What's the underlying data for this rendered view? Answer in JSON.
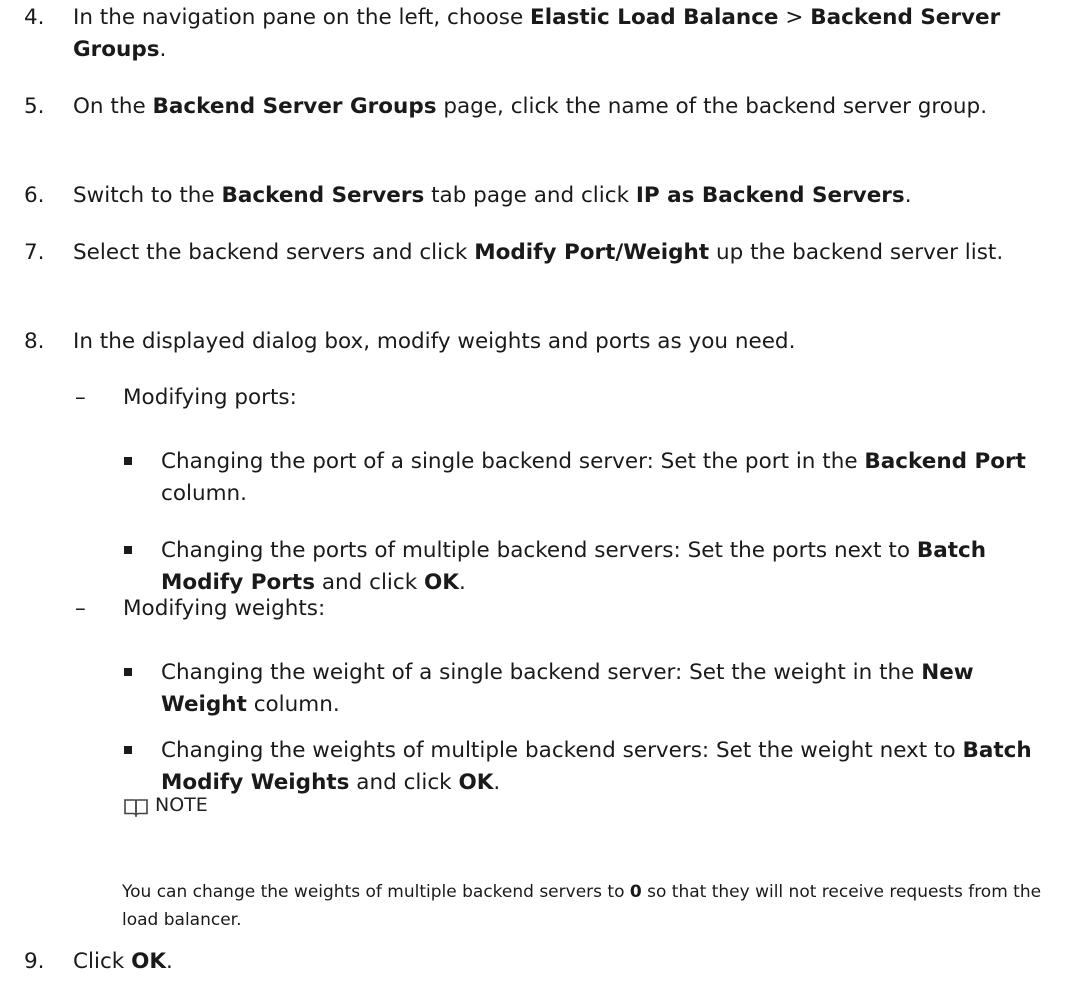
{
  "steps": [
    {
      "num": "4.",
      "parts": [
        {
          "t": "In the navigation pane on the left, choose "
        },
        {
          "b": "Elastic Load Balance"
        },
        {
          "t": " > "
        },
        {
          "b": "Backend Server Groups"
        },
        {
          "t": "."
        }
      ]
    },
    {
      "num": "5.",
      "parts": [
        {
          "t": "On the "
        },
        {
          "b": "Backend Server Groups"
        },
        {
          "t": " page, click the name of the backend server group."
        }
      ]
    },
    {
      "num": "6.",
      "parts": [
        {
          "t": "Switch to the "
        },
        {
          "b": "Backend Servers"
        },
        {
          "t": " tab page and click "
        },
        {
          "b": "IP as Backend Servers"
        },
        {
          "t": "."
        }
      ]
    },
    {
      "num": "7.",
      "parts": [
        {
          "t": "Select the backend servers and click "
        },
        {
          "b": "Modify Port/Weight"
        },
        {
          "t": " up the backend server list."
        }
      ]
    },
    {
      "num": "8.",
      "parts": [
        {
          "t": "In the displayed dialog box, modify weights and ports as you need."
        }
      ]
    },
    {
      "num": "9.",
      "parts": [
        {
          "t": "Click "
        },
        {
          "b": "OK"
        },
        {
          "t": "."
        }
      ]
    }
  ],
  "substeps": [
    {
      "dash": "–",
      "label": "Modifying ports:",
      "bullets": [
        [
          {
            "t": "Changing the port of a single backend server: Set the port in the "
          },
          {
            "b": "Backend Port"
          },
          {
            "t": " column."
          }
        ],
        [
          {
            "t": "Changing the ports of multiple backend servers: Set the ports next to "
          },
          {
            "b": "Batch Modify Ports"
          },
          {
            "t": " and click "
          },
          {
            "b": "OK"
          },
          {
            "t": "."
          }
        ]
      ]
    },
    {
      "dash": "–",
      "label": "Modifying weights:",
      "bullets": [
        [
          {
            "t": "Changing the weight of a single backend server: Set the weight in the "
          },
          {
            "b": "New Weight"
          },
          {
            "t": " column."
          }
        ],
        [
          {
            "t": "Changing the weights of multiple backend servers: Set the weight next to "
          },
          {
            "b": "Batch Modify Weights"
          },
          {
            "t": " and click "
          },
          {
            "b": "OK"
          },
          {
            "t": "."
          }
        ]
      ]
    }
  ],
  "note": {
    "icon": "book-icon",
    "label": "NOTE",
    "parts": [
      {
        "t": "You can change the weights of multiple backend servers to "
      },
      {
        "b": "0"
      },
      {
        "t": " so that they will not receive requests from the load balancer."
      }
    ]
  }
}
